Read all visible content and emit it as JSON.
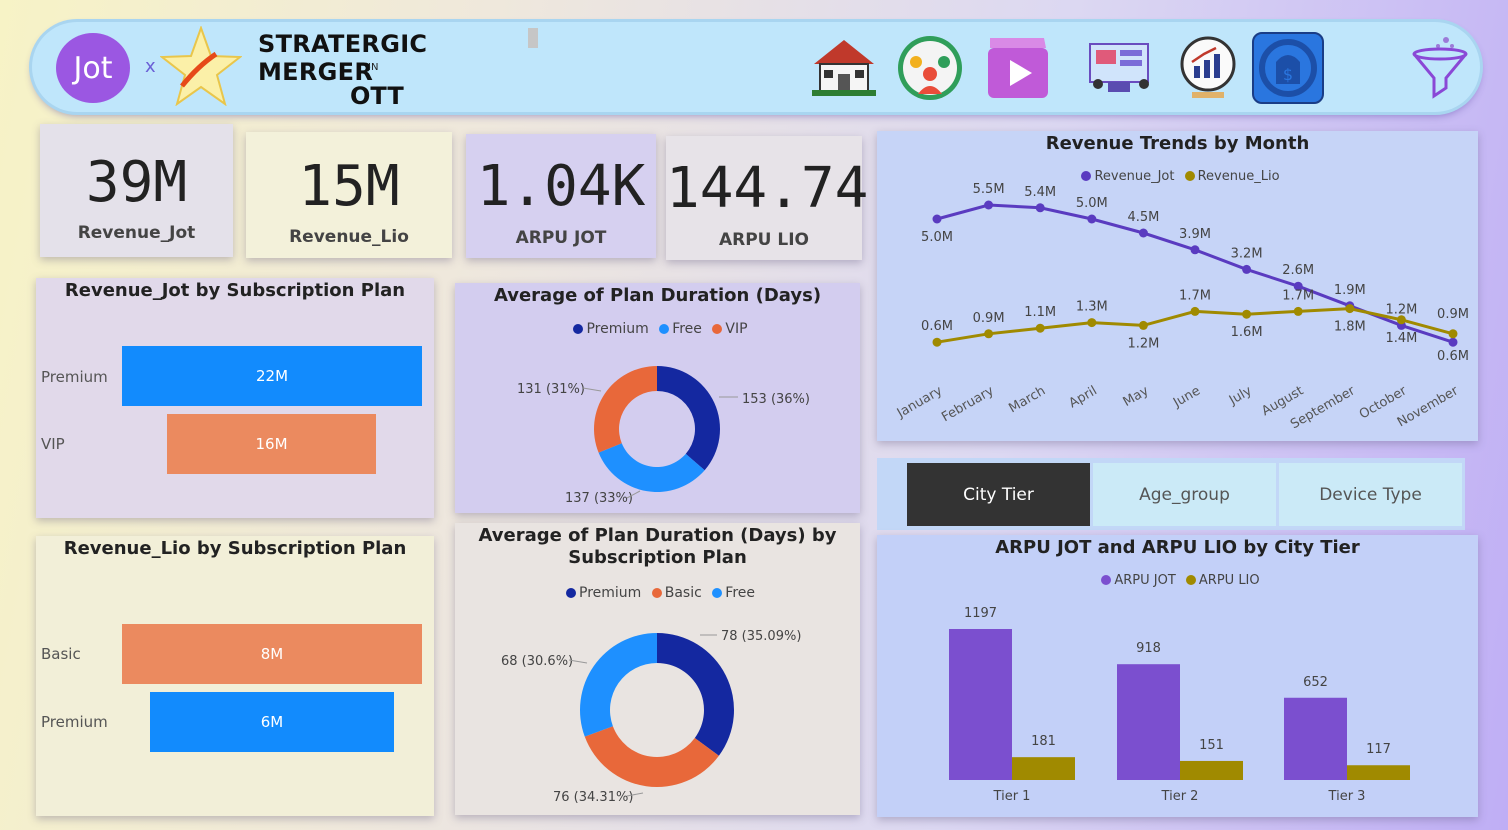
{
  "header": {
    "logo_text": "Jot",
    "separator": "x",
    "title": "STRATERGIC MERGER",
    "in_text": "IN",
    "subtitle": "OTT",
    "nav_icons": [
      "home-icon",
      "people-group-icon",
      "video-play-icon",
      "presentation-icon",
      "growth-chart-icon",
      "money-icon",
      "filter-icon"
    ]
  },
  "kpis": [
    {
      "value": "39M",
      "label": "Revenue_Jot",
      "bg": "#e4e1ea"
    },
    {
      "value": "15M",
      "label": "Revenue_Lio",
      "bg": "#f3f1da"
    },
    {
      "value": "1.04K",
      "label": "ARPU JOT",
      "bg": "#d6d0f0"
    },
    {
      "value": "144.74",
      "label": "ARPU LIO",
      "bg": "#e7e3e8"
    }
  ],
  "rev_jot_plan": {
    "title": "Revenue_Jot by Subscription Plan",
    "rows": [
      {
        "label": "Premium",
        "value_label": "22M",
        "value": 22,
        "color": "#128bfd"
      },
      {
        "label": "VIP",
        "value_label": "16M",
        "value": 16,
        "color": "#eb8a5f"
      }
    ]
  },
  "rev_lio_plan": {
    "title": "Revenue_Lio by Subscription Plan",
    "rows": [
      {
        "label": "Basic",
        "value_label": "8M",
        "value": 8,
        "color": "#eb8a5f"
      },
      {
        "label": "Premium",
        "value_label": "6M",
        "value": 6,
        "color": "#128bfd"
      }
    ]
  },
  "donut1": {
    "title": "Average of Plan Duration (Days)",
    "legend": [
      {
        "name": "Premium",
        "color": "#1428a0"
      },
      {
        "name": "Free",
        "color": "#1e90ff"
      },
      {
        "name": "VIP",
        "color": "#e8683a"
      }
    ],
    "slices": [
      {
        "name": "Premium",
        "value": 153,
        "label": "153 (36%)",
        "color": "#1428a0"
      },
      {
        "name": "Free",
        "value": 137,
        "label": "137 (33%)",
        "color": "#1e90ff"
      },
      {
        "name": "VIP",
        "value": 131,
        "label": "131 (31%)",
        "color": "#e8683a"
      }
    ]
  },
  "donut2": {
    "title_line1": "Average of Plan Duration (Days) by",
    "title_line2": "Subscription Plan",
    "legend": [
      {
        "name": "Premium",
        "color": "#1428a0"
      },
      {
        "name": "Basic",
        "color": "#e8683a"
      },
      {
        "name": "Free",
        "color": "#1e90ff"
      }
    ],
    "slices": [
      {
        "name": "Premium",
        "value": 78,
        "label": "78 (35.09%)",
        "color": "#1428a0"
      },
      {
        "name": "Basic",
        "value": 76,
        "label": "76 (34.31%)",
        "color": "#e8683a"
      },
      {
        "name": "Free",
        "value": 68,
        "label": "68 (30.6%)",
        "color": "#1e90ff"
      }
    ]
  },
  "trend": {
    "title": "Revenue Trends by Month",
    "legend": [
      {
        "name": "Revenue_Jot",
        "color": "#5a3bc0"
      },
      {
        "name": "Revenue_Lio",
        "color": "#a08a00"
      }
    ]
  },
  "tabs": [
    {
      "label": "City Tier",
      "active": true
    },
    {
      "label": "Age_group",
      "active": false
    },
    {
      "label": "Device Type",
      "active": false
    }
  ],
  "arpu_tier": {
    "title": "ARPU JOT and ARPU LIO by City Tier",
    "legend": [
      {
        "name": "ARPU JOT",
        "color": "#7b4fcf"
      },
      {
        "name": "ARPU LIO",
        "color": "#a08a00"
      }
    ]
  },
  "chart_data": [
    {
      "type": "line",
      "title": "Revenue Trends by Month",
      "x": [
        "January",
        "February",
        "March",
        "April",
        "May",
        "June",
        "July",
        "August",
        "September",
        "October",
        "November"
      ],
      "series": [
        {
          "name": "Revenue_Jot",
          "values": [
            5.0,
            5.5,
            5.4,
            5.0,
            4.5,
            3.9,
            3.2,
            2.6,
            1.9,
            1.2,
            0.6
          ],
          "labels": [
            "5.0M",
            "5.5M",
            "5.4M",
            "5.0M",
            "4.5M",
            "3.9M",
            "3.2M",
            "2.6M",
            "1.9M",
            "1.2M",
            "0.6M"
          ],
          "color": "#5a3bc0"
        },
        {
          "name": "Revenue_Lio",
          "values": [
            0.6,
            0.9,
            1.1,
            1.3,
            1.2,
            1.7,
            1.6,
            1.7,
            1.8,
            1.4,
            0.9
          ],
          "labels": [
            "0.6M",
            "0.9M",
            "1.1M",
            "1.3M",
            "1.2M",
            "1.7M",
            "1.6M",
            "1.7M",
            "1.8M",
            "1.4M",
            "0.9M"
          ],
          "color": "#a08a00"
        }
      ],
      "ylim": [
        0,
        6
      ]
    },
    {
      "type": "bar",
      "title": "ARPU JOT and ARPU LIO by City Tier",
      "categories": [
        "Tier 1",
        "Tier 2",
        "Tier 3"
      ],
      "series": [
        {
          "name": "ARPU JOT",
          "values": [
            1197,
            918,
            652
          ],
          "color": "#7b4fcf"
        },
        {
          "name": "ARPU LIO",
          "values": [
            181,
            151,
            117
          ],
          "color": "#a08a00"
        }
      ],
      "ylim": [
        0,
        1300
      ]
    }
  ]
}
